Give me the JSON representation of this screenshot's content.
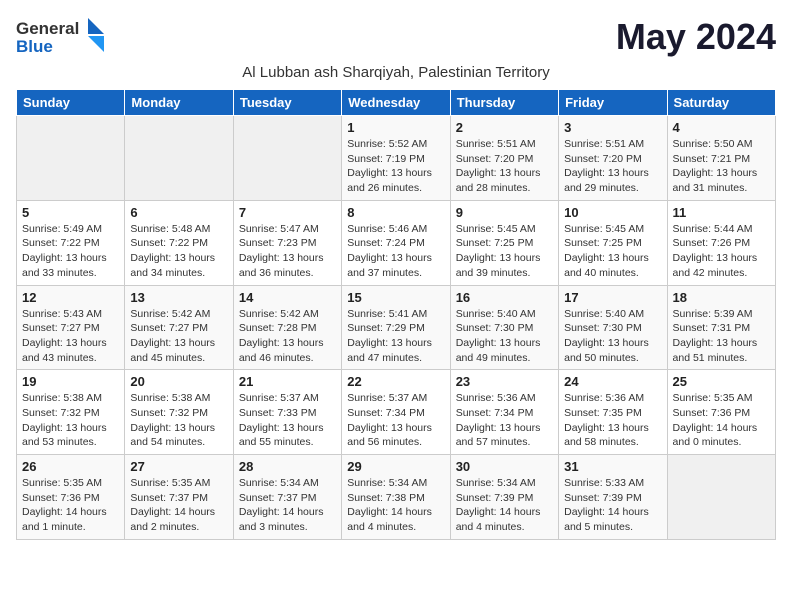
{
  "header": {
    "logo_general": "General",
    "logo_blue": "Blue",
    "month_title": "May 2024",
    "subtitle": "Al Lubban ash Sharqiyah, Palestinian Territory"
  },
  "days_of_week": [
    "Sunday",
    "Monday",
    "Tuesday",
    "Wednesday",
    "Thursday",
    "Friday",
    "Saturday"
  ],
  "weeks": [
    [
      {
        "day": "",
        "info": ""
      },
      {
        "day": "",
        "info": ""
      },
      {
        "day": "",
        "info": ""
      },
      {
        "day": "1",
        "info": "Sunrise: 5:52 AM\nSunset: 7:19 PM\nDaylight: 13 hours\nand 26 minutes."
      },
      {
        "day": "2",
        "info": "Sunrise: 5:51 AM\nSunset: 7:20 PM\nDaylight: 13 hours\nand 28 minutes."
      },
      {
        "day": "3",
        "info": "Sunrise: 5:51 AM\nSunset: 7:20 PM\nDaylight: 13 hours\nand 29 minutes."
      },
      {
        "day": "4",
        "info": "Sunrise: 5:50 AM\nSunset: 7:21 PM\nDaylight: 13 hours\nand 31 minutes."
      }
    ],
    [
      {
        "day": "5",
        "info": "Sunrise: 5:49 AM\nSunset: 7:22 PM\nDaylight: 13 hours\nand 33 minutes."
      },
      {
        "day": "6",
        "info": "Sunrise: 5:48 AM\nSunset: 7:22 PM\nDaylight: 13 hours\nand 34 minutes."
      },
      {
        "day": "7",
        "info": "Sunrise: 5:47 AM\nSunset: 7:23 PM\nDaylight: 13 hours\nand 36 minutes."
      },
      {
        "day": "8",
        "info": "Sunrise: 5:46 AM\nSunset: 7:24 PM\nDaylight: 13 hours\nand 37 minutes."
      },
      {
        "day": "9",
        "info": "Sunrise: 5:45 AM\nSunset: 7:25 PM\nDaylight: 13 hours\nand 39 minutes."
      },
      {
        "day": "10",
        "info": "Sunrise: 5:45 AM\nSunset: 7:25 PM\nDaylight: 13 hours\nand 40 minutes."
      },
      {
        "day": "11",
        "info": "Sunrise: 5:44 AM\nSunset: 7:26 PM\nDaylight: 13 hours\nand 42 minutes."
      }
    ],
    [
      {
        "day": "12",
        "info": "Sunrise: 5:43 AM\nSunset: 7:27 PM\nDaylight: 13 hours\nand 43 minutes."
      },
      {
        "day": "13",
        "info": "Sunrise: 5:42 AM\nSunset: 7:27 PM\nDaylight: 13 hours\nand 45 minutes."
      },
      {
        "day": "14",
        "info": "Sunrise: 5:42 AM\nSunset: 7:28 PM\nDaylight: 13 hours\nand 46 minutes."
      },
      {
        "day": "15",
        "info": "Sunrise: 5:41 AM\nSunset: 7:29 PM\nDaylight: 13 hours\nand 47 minutes."
      },
      {
        "day": "16",
        "info": "Sunrise: 5:40 AM\nSunset: 7:30 PM\nDaylight: 13 hours\nand 49 minutes."
      },
      {
        "day": "17",
        "info": "Sunrise: 5:40 AM\nSunset: 7:30 PM\nDaylight: 13 hours\nand 50 minutes."
      },
      {
        "day": "18",
        "info": "Sunrise: 5:39 AM\nSunset: 7:31 PM\nDaylight: 13 hours\nand 51 minutes."
      }
    ],
    [
      {
        "day": "19",
        "info": "Sunrise: 5:38 AM\nSunset: 7:32 PM\nDaylight: 13 hours\nand 53 minutes."
      },
      {
        "day": "20",
        "info": "Sunrise: 5:38 AM\nSunset: 7:32 PM\nDaylight: 13 hours\nand 54 minutes."
      },
      {
        "day": "21",
        "info": "Sunrise: 5:37 AM\nSunset: 7:33 PM\nDaylight: 13 hours\nand 55 minutes."
      },
      {
        "day": "22",
        "info": "Sunrise: 5:37 AM\nSunset: 7:34 PM\nDaylight: 13 hours\nand 56 minutes."
      },
      {
        "day": "23",
        "info": "Sunrise: 5:36 AM\nSunset: 7:34 PM\nDaylight: 13 hours\nand 57 minutes."
      },
      {
        "day": "24",
        "info": "Sunrise: 5:36 AM\nSunset: 7:35 PM\nDaylight: 13 hours\nand 58 minutes."
      },
      {
        "day": "25",
        "info": "Sunrise: 5:35 AM\nSunset: 7:36 PM\nDaylight: 14 hours\nand 0 minutes."
      }
    ],
    [
      {
        "day": "26",
        "info": "Sunrise: 5:35 AM\nSunset: 7:36 PM\nDaylight: 14 hours\nand 1 minute."
      },
      {
        "day": "27",
        "info": "Sunrise: 5:35 AM\nSunset: 7:37 PM\nDaylight: 14 hours\nand 2 minutes."
      },
      {
        "day": "28",
        "info": "Sunrise: 5:34 AM\nSunset: 7:37 PM\nDaylight: 14 hours\nand 3 minutes."
      },
      {
        "day": "29",
        "info": "Sunrise: 5:34 AM\nSunset: 7:38 PM\nDaylight: 14 hours\nand 4 minutes."
      },
      {
        "day": "30",
        "info": "Sunrise: 5:34 AM\nSunset: 7:39 PM\nDaylight: 14 hours\nand 4 minutes."
      },
      {
        "day": "31",
        "info": "Sunrise: 5:33 AM\nSunset: 7:39 PM\nDaylight: 14 hours\nand 5 minutes."
      },
      {
        "day": "",
        "info": ""
      }
    ]
  ]
}
